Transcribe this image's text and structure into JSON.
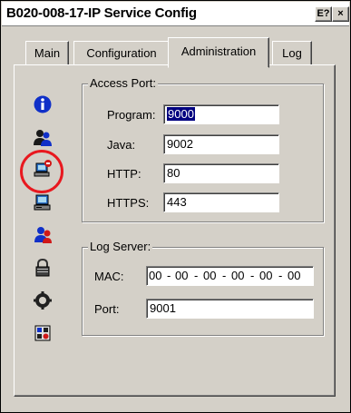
{
  "window": {
    "title": "B020-008-17-IP Service Config",
    "help_button": "E?",
    "close_button": "×"
  },
  "tabs": [
    {
      "label": "Main"
    },
    {
      "label": "Configuration"
    },
    {
      "label": "Administration",
      "active": true
    },
    {
      "label": "Log"
    }
  ],
  "sidebar": {
    "icons": [
      "info-icon",
      "users-icon",
      "network-config-icon",
      "computer-icon",
      "user-admin-icon",
      "lock-icon",
      "settings-icon",
      "device-icon"
    ],
    "highlighted_icon": "network-config-icon",
    "highlight_color": "#e8181f"
  },
  "access_port": {
    "legend": "Access Port:",
    "program_label": "Program:",
    "program_value": "9000",
    "java_label": "Java:",
    "java_value": "9002",
    "http_label": "HTTP:",
    "http_value": "80",
    "https_label": "HTTPS:",
    "https_value": "443"
  },
  "log_server": {
    "legend": "Log Server:",
    "mac_label": "MAC:",
    "mac_values": [
      "00",
      "00",
      "00",
      "00",
      "00",
      "00"
    ],
    "port_label": "Port:",
    "port_value": "9001"
  },
  "colors": {
    "selection": "#000080",
    "face": "#d4d0c8"
  }
}
